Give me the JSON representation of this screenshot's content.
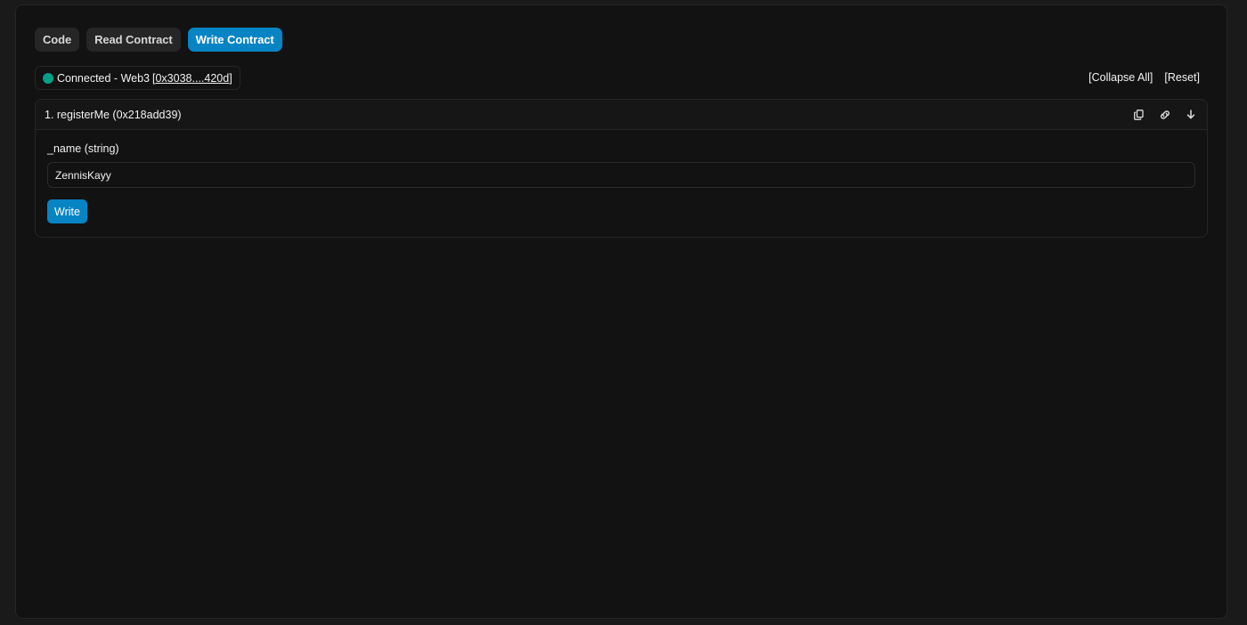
{
  "tabs": [
    {
      "label": "Code",
      "active": false
    },
    {
      "label": "Read Contract",
      "active": false
    },
    {
      "label": "Write Contract",
      "active": true
    }
  ],
  "connection": {
    "status_text": "Connected - Web3",
    "bracket_open": "[",
    "address": "0x3038....420d",
    "bracket_close": "]",
    "indicator_color": "#00a186"
  },
  "actions": {
    "collapse_all": "[Collapse All]",
    "reset": "[Reset]"
  },
  "functions": [
    {
      "title": "1. registerMe (0x218add39)",
      "icons": [
        "copy-icon",
        "link-icon",
        "arrow-down-icon"
      ],
      "inputs": [
        {
          "label": "_name (string)",
          "value": "ZennisKayy",
          "placeholder": ""
        }
      ],
      "button_label": "Write"
    }
  ],
  "colors": {
    "accent": "#0784c3",
    "background": "#121212",
    "tab_inactive": "#262626"
  }
}
